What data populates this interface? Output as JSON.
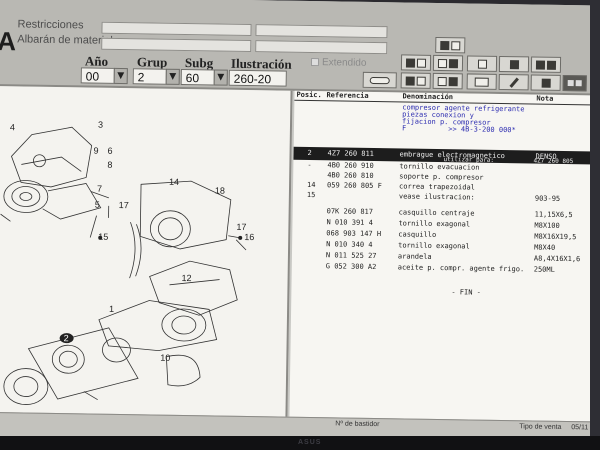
{
  "header": {
    "logo": "A",
    "restricciones_label": "Restricciones",
    "albaran_label": "Albarán de material",
    "anio_label": "Año",
    "anio_value": "00",
    "grup_label": "Grup",
    "grup_value": "2",
    "subg_label": "Subg",
    "subg_value": "60",
    "ilustracion_label": "Ilustración",
    "ilustracion_value": "260-20",
    "extendido_label": "Extendido"
  },
  "table": {
    "headers": [
      "Posic.",
      "Referencia",
      "Denominación",
      "Nota"
    ],
    "description_block": "compresor agente refrigerante\npiezas conexion y\nfijacion p. compresor\nF          >> 4B-3-200 000*",
    "rows": [
      {
        "pos": "2",
        "ref": "4Z7 260 811",
        "name": "embrague electromagnetico",
        "name2": "utilizar para:",
        "note": "DENSO",
        "note2": "4Z7 260 805",
        "selected": true
      },
      {
        "pos": "-",
        "ref": "4B0 260 910",
        "name": "tornillo evacuacion",
        "note": ""
      },
      {
        "pos": "",
        "ref": "4B0 260 810",
        "name": "soporte p. compresor",
        "note": ""
      },
      {
        "pos": "14",
        "ref": "059 260 805 F",
        "name": "correa trapezoidal",
        "note": ""
      },
      {
        "pos": "15",
        "ref": "",
        "name": "vease ilustracion:",
        "note": "903-95"
      },
      {
        "pos": "",
        "ref": "07K 260 817",
        "name": "casquillo centraje",
        "note": "11,15X6,5"
      },
      {
        "pos": "",
        "ref": "N  010 391 4",
        "name": "tornillo exagonal",
        "note": "M8X100"
      },
      {
        "pos": "",
        "ref": "068 903 147 H",
        "name": "casquillo",
        "note": "M8X16X19,5"
      },
      {
        "pos": "",
        "ref": "N  010 340 4",
        "name": "tornillo exagonal",
        "note": "M8X40"
      },
      {
        "pos": "",
        "ref": "N  011 525 27",
        "name": "arandela",
        "note": "A8,4X16X1,6"
      },
      {
        "pos": "",
        "ref": "G  052 300 A2",
        "name": "aceite p. compr. agente frigo.",
        "note": "250ML"
      }
    ],
    "fin": "- FIN -"
  },
  "drawing": {
    "callouts": [
      "4",
      "3",
      "6",
      "9",
      "8",
      "5",
      "7",
      "17",
      "14",
      "18",
      "16",
      "17",
      "15",
      "12",
      "1",
      "2",
      "10"
    ]
  },
  "status": {
    "left": "33",
    "center": "Nº de bastidor",
    "right": "Tipo de venta",
    "far_right": "05/11"
  },
  "bezel_brand": "ASUS"
}
